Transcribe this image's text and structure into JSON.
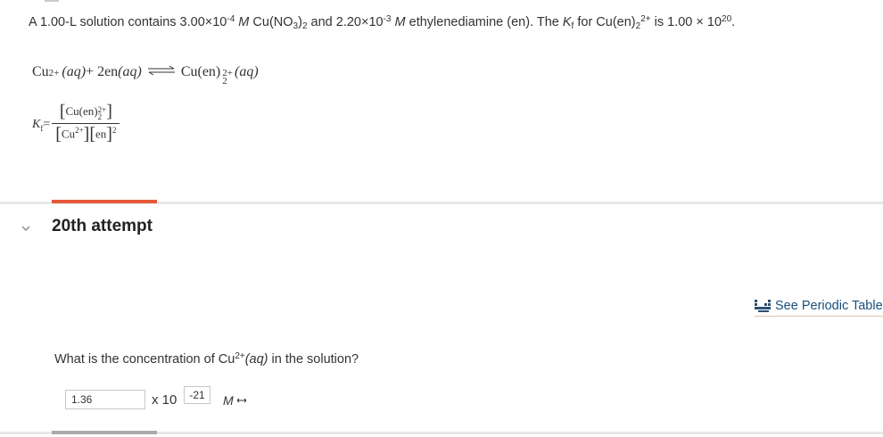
{
  "problem": {
    "p1": "A 1.00-L solution contains 3.00×10",
    "exp1": "-4",
    "p2": " M",
    "p3": " Cu(NO",
    "sub1": "3",
    "p4": ")",
    "sub2": "2",
    "p5": " and 2.20×10",
    "exp2": "-3",
    "p6": " M",
    "p7": " ethylenediamine (en). The ",
    "kf_k": "K",
    "kf_f": "f",
    "p8": " for Cu(en)",
    "sub3": "2",
    "sup3": "2+",
    "p9": " is 1.00 × 10",
    "exp3": "20",
    "p10": "."
  },
  "equation": {
    "left_ion": "Cu",
    "left_charge": "2+",
    "left_state": "(aq)",
    "plus": " + 2en",
    "mid_state": "(aq)",
    "right_complex": "Cu(en)",
    "right_charge": "2+",
    "right_sub": "2",
    "right_state": "(aq)"
  },
  "kf_expression": {
    "k": "K",
    "f": "f",
    "eq": "=",
    "num_complex": "Cu(en)",
    "num_charge": "2+",
    "num_sub": "2",
    "den_ion": "Cu",
    "den_charge": "2+",
    "den_en": "en",
    "den_pow": "2"
  },
  "attempt": {
    "label": "20th attempt"
  },
  "periodic_table": {
    "label": "See Periodic Table"
  },
  "question": {
    "q1": "What is the concentration of Cu",
    "q_charge": "2+",
    "q_state": "(aq)",
    "q2": " in the solution?"
  },
  "answer": {
    "value": "1.36",
    "times": "x 10",
    "exponent": "-21",
    "unit": "M"
  },
  "colors": {
    "accent": "#e4583a",
    "link": "#1a4f7a"
  },
  "icons": {
    "expand": "chevron-down-icon",
    "periodic": "periodic-table-icon",
    "unit_dropdown": "double-arrow-icon"
  }
}
